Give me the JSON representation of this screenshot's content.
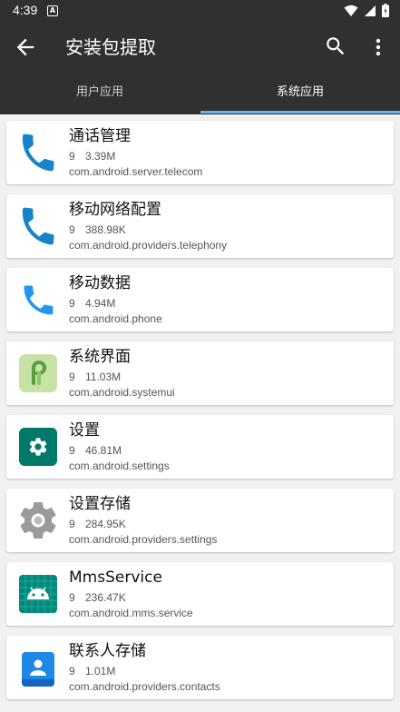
{
  "status_bar": {
    "time": "4:39",
    "notification_badge": "A"
  },
  "app_bar": {
    "title": "安装包提取"
  },
  "tabs": [
    {
      "label": "用户应用",
      "selected": false
    },
    {
      "label": "系统应用",
      "selected": true
    }
  ],
  "colors": {
    "bar": "#303030",
    "accent": "#6ab3e8"
  },
  "apps": [
    {
      "name": "通话管理",
      "version": "9",
      "size": "3.39M",
      "package": "com.android.server.telecom",
      "icon": "phone-icon"
    },
    {
      "name": "移动网络配置",
      "version": "9",
      "size": "388.98K",
      "package": "com.android.providers.telephony",
      "icon": "phone-icon"
    },
    {
      "name": "移动数据",
      "version": "9",
      "size": "4.94M",
      "package": "com.android.phone",
      "icon": "phone-flat-icon"
    },
    {
      "name": "系统界面",
      "version": "9",
      "size": "11.03M",
      "package": "com.android.systemui",
      "icon": "android-p-icon"
    },
    {
      "name": "设置",
      "version": "9",
      "size": "46.81M",
      "package": "com.android.settings",
      "icon": "settings-gear-icon"
    },
    {
      "name": "设置存储",
      "version": "9",
      "size": "284.95K",
      "package": "com.android.providers.settings",
      "icon": "gray-gear-icon"
    },
    {
      "name": "MmsService",
      "version": "9",
      "size": "236.47K",
      "package": "com.android.mms.service",
      "icon": "android-robot-icon"
    },
    {
      "name": "联系人存储",
      "version": "9",
      "size": "1.01M",
      "package": "com.android.providers.contacts",
      "icon": "contacts-icon"
    }
  ]
}
